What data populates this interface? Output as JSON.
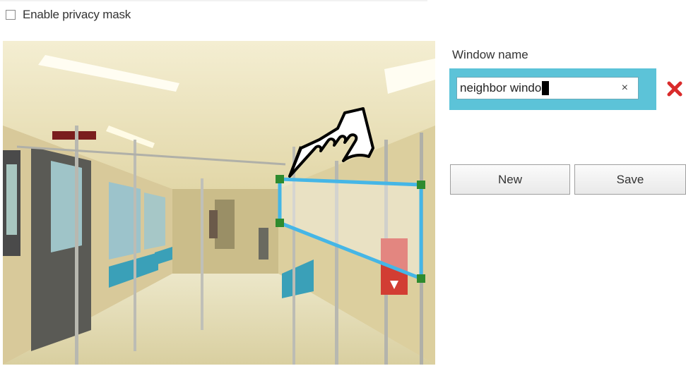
{
  "privacy": {
    "checkbox_checked": false,
    "label": "Enable privacy mask"
  },
  "camera": {
    "mask_color": "#45b6e6",
    "handle_color": "#2e8b2e",
    "cursor_icon": "hand-pointer-icon"
  },
  "panel": {
    "window_name_label": "Window name",
    "window_name_value": "neighbor windo",
    "clear_symbol": "×",
    "delete_icon": "red-x-icon",
    "delete_color": "#d92b2b",
    "frame_color": "#5cc3d8"
  },
  "buttons": {
    "new_label": "New",
    "save_label": "Save"
  }
}
